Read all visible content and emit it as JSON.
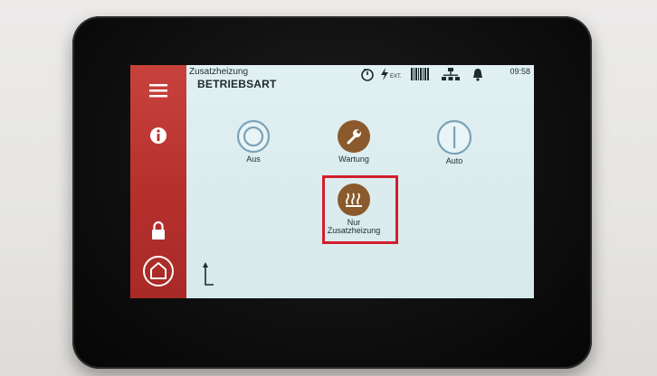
{
  "header": {
    "breadcrumb": "Zusatzheizung",
    "title": "BETRIEBSART",
    "status_ext": "EXT.",
    "time": "09:58"
  },
  "sidebar": {
    "items": [
      {
        "icon": "menu-icon"
      },
      {
        "icon": "info-icon"
      },
      {
        "icon": "lock-icon"
      },
      {
        "icon": "home-icon"
      }
    ]
  },
  "modes": [
    {
      "label": "Aus",
      "icon": "off-ring-icon",
      "state": "inactive"
    },
    {
      "label": "Wartung",
      "icon": "wrench-icon",
      "state": "active"
    },
    {
      "label": "Auto",
      "icon": "auto-icon",
      "state": "inactive"
    },
    {
      "label_line1": "Nur",
      "label_line2": "Zusatzheizung",
      "icon": "heater-icon",
      "state": "active-selected"
    }
  ],
  "colors": {
    "sidebar_red": "#b5302d",
    "active_brown": "#8a5a2c",
    "outline_blue": "#7aa3b8",
    "highlight_red": "#d0202c"
  }
}
